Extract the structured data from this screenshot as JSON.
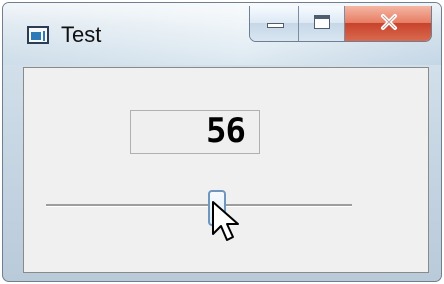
{
  "window": {
    "title": "Test"
  },
  "icons": {
    "app": "application-icon",
    "minimize": "minimize-icon",
    "maximize": "maximize-icon",
    "close": "close-icon",
    "cursor": "pointer-cursor-icon"
  },
  "display": {
    "value": "56"
  },
  "slider": {
    "value": 56,
    "min": 0,
    "max": 100
  }
}
